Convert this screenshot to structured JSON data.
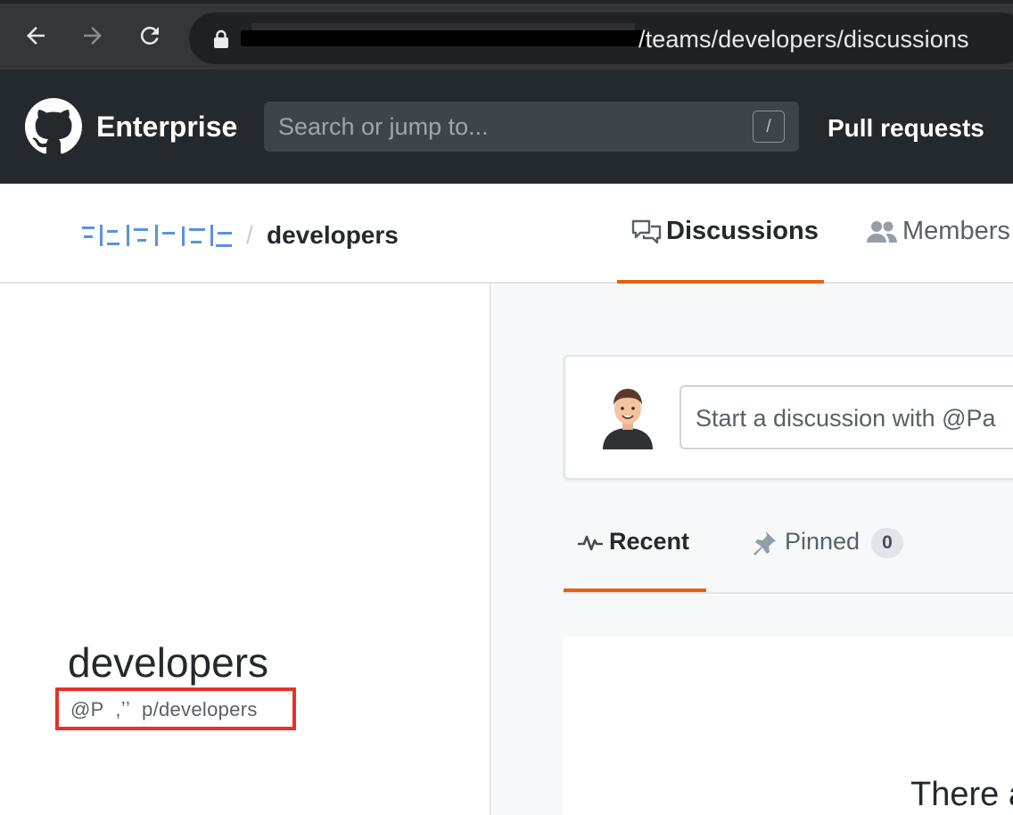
{
  "browser": {
    "url_suffix": "/teams/developers/discussions",
    "icons": {
      "back": "arrow-left-icon",
      "forward": "arrow-right-icon",
      "reload": "reload-icon",
      "lock": "lock-icon"
    }
  },
  "header": {
    "brand": "Enterprise",
    "search_placeholder": "Search or jump to...",
    "search_shortcut": "/",
    "nav": {
      "pull_requests": "Pull requests"
    },
    "colors": {
      "background": "#24292e",
      "search_bg": "#3f4448"
    }
  },
  "team_header": {
    "breadcrumb_separator": "/",
    "team": "developers",
    "tabs": [
      {
        "label": "Discussions",
        "icon": "comment-discussion-icon",
        "selected": true
      },
      {
        "label": "Members",
        "icon": "people-icon",
        "selected": false
      }
    ],
    "colors": {
      "selected_tab_underline": "#e36209"
    }
  },
  "sidebar": {
    "team_name": "developers",
    "team_handle": "@P  ,ʼʼ  p/developers",
    "colors": {
      "highlight_box": "#e53228"
    }
  },
  "main": {
    "composer": {
      "placeholder": "Start a discussion with @Pa"
    },
    "tabs": [
      {
        "label": "Recent",
        "icon": "pulse-icon",
        "selected": true
      },
      {
        "label": "Pinned",
        "icon": "pin-icon",
        "count": "0",
        "selected": false
      }
    ],
    "empty_state": "There a"
  }
}
